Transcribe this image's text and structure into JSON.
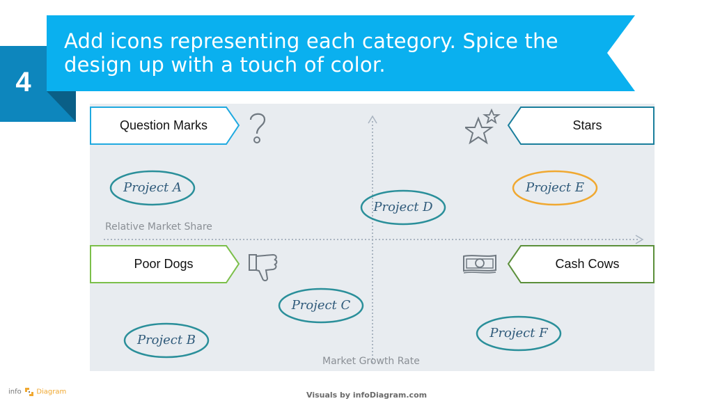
{
  "slide": {
    "step_number": "4",
    "headline_line1": "Add icons representing each category. Spice the",
    "headline_line2": "design up with a touch of color.",
    "colors": {
      "banner": "#0ab0ef",
      "number_block": "#0d86bd",
      "number_fold": "#0a5f87",
      "matrix_bg": "#e8ecf0",
      "blue_outline": "#1fa9e0",
      "teal_outline": "#1a7e9c",
      "green_outline": "#7bbf4a",
      "dark_green_outline": "#5b8f3a",
      "orange_ellipse": "#f0a830",
      "teal_ellipse": "#2a8f9a"
    }
  },
  "matrix": {
    "x_axis_label": "Relative Market Share",
    "y_axis_label": "Market Growth Rate",
    "quadrants": [
      {
        "label": "Question Marks",
        "icon": "question-mark-icon"
      },
      {
        "label": "Stars",
        "icon": "stars-icon"
      },
      {
        "label": "Poor Dogs",
        "icon": "thumbs-down-icon"
      },
      {
        "label": "Cash Cows",
        "icon": "banknote-icon"
      }
    ],
    "projects": [
      {
        "label": "Project A",
        "quadrant": "Question Marks"
      },
      {
        "label": "Project B",
        "quadrant": "Poor Dogs"
      },
      {
        "label": "Project C",
        "quadrant": "Poor Dogs"
      },
      {
        "label": "Project D",
        "quadrant": "Center"
      },
      {
        "label": "Project E",
        "quadrant": "Stars"
      },
      {
        "label": "Project F",
        "quadrant": "Cash Cows"
      }
    ]
  },
  "footer": {
    "logo_info": "info",
    "logo_diagram": "Diagram",
    "credit": "Visuals by infoDiagram.com"
  }
}
